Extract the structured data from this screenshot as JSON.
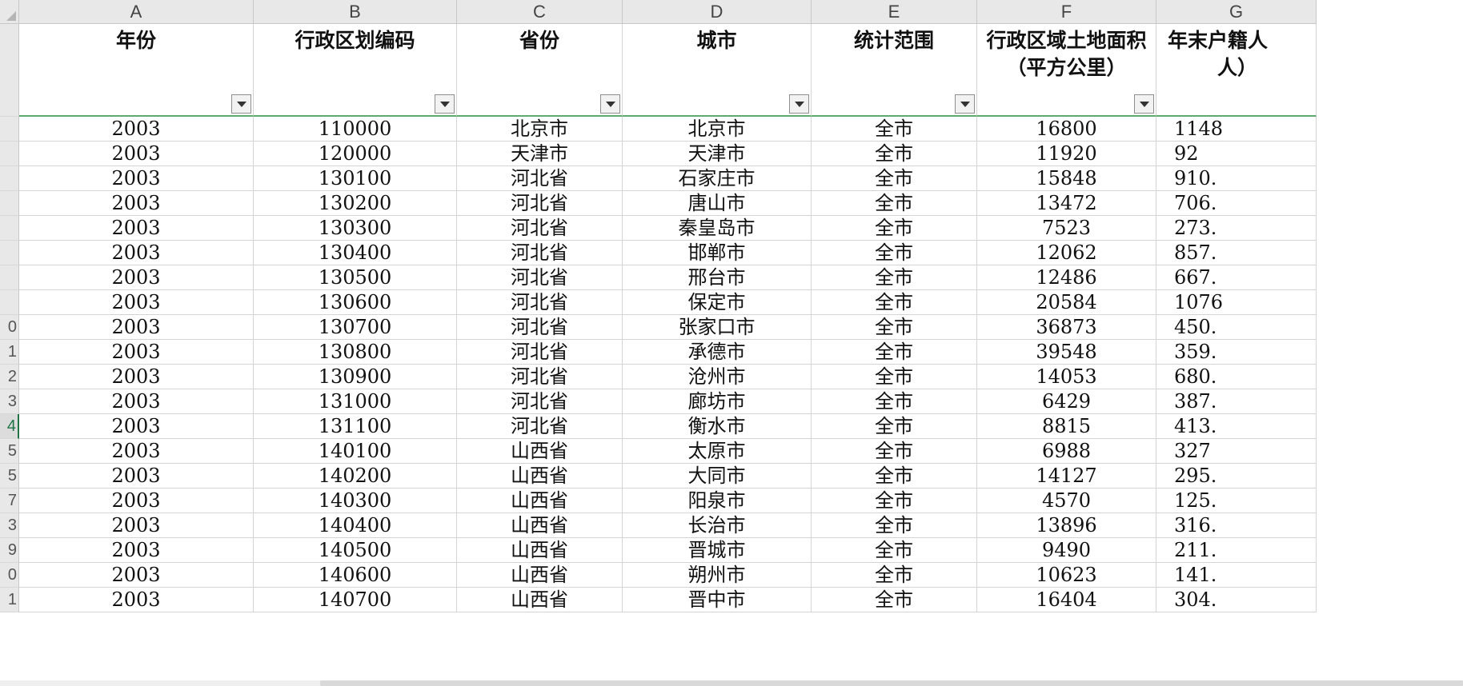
{
  "columns": [
    {
      "letter": "A",
      "header_lines": [
        "年份"
      ]
    },
    {
      "letter": "B",
      "header_lines": [
        "行政区划编码"
      ]
    },
    {
      "letter": "C",
      "header_lines": [
        "省份"
      ]
    },
    {
      "letter": "D",
      "header_lines": [
        "城市"
      ]
    },
    {
      "letter": "E",
      "header_lines": [
        "统计范围"
      ]
    },
    {
      "letter": "F",
      "header_lines": [
        "行政区域土地面积",
        "（平方公里）"
      ]
    },
    {
      "letter": "G",
      "header_lines": [
        "年末户籍人",
        "人）"
      ]
    }
  ],
  "row_numbers": [
    "",
    "",
    "",
    "",
    "",
    "",
    "",
    "",
    "",
    "0",
    "1",
    "2",
    "3",
    "4",
    "5",
    "5",
    "7",
    "3",
    "9",
    "0",
    "1"
  ],
  "active_row_index": 12,
  "rows": [
    [
      "2003",
      "110000",
      "北京市",
      "北京市",
      "全市",
      "16800",
      "1148"
    ],
    [
      "2003",
      "120000",
      "天津市",
      "天津市",
      "全市",
      "11920",
      "92"
    ],
    [
      "2003",
      "130100",
      "河北省",
      "石家庄市",
      "全市",
      "15848",
      "910."
    ],
    [
      "2003",
      "130200",
      "河北省",
      "唐山市",
      "全市",
      "13472",
      "706."
    ],
    [
      "2003",
      "130300",
      "河北省",
      "秦皇岛市",
      "全市",
      "7523",
      "273."
    ],
    [
      "2003",
      "130400",
      "河北省",
      "邯郸市",
      "全市",
      "12062",
      "857."
    ],
    [
      "2003",
      "130500",
      "河北省",
      "邢台市",
      "全市",
      "12486",
      "667."
    ],
    [
      "2003",
      "130600",
      "河北省",
      "保定市",
      "全市",
      "20584",
      "1076"
    ],
    [
      "2003",
      "130700",
      "河北省",
      "张家口市",
      "全市",
      "36873",
      "450."
    ],
    [
      "2003",
      "130800",
      "河北省",
      "承德市",
      "全市",
      "39548",
      "359."
    ],
    [
      "2003",
      "130900",
      "河北省",
      "沧州市",
      "全市",
      "14053",
      "680."
    ],
    [
      "2003",
      "131000",
      "河北省",
      "廊坊市",
      "全市",
      "6429",
      "387."
    ],
    [
      "2003",
      "131100",
      "河北省",
      "衡水市",
      "全市",
      "8815",
      "413."
    ],
    [
      "2003",
      "140100",
      "山西省",
      "太原市",
      "全市",
      "6988",
      "327"
    ],
    [
      "2003",
      "140200",
      "山西省",
      "大同市",
      "全市",
      "14127",
      "295."
    ],
    [
      "2003",
      "140300",
      "山西省",
      "阳泉市",
      "全市",
      "4570",
      "125."
    ],
    [
      "2003",
      "140400",
      "山西省",
      "长治市",
      "全市",
      "13896",
      "316."
    ],
    [
      "2003",
      "140500",
      "山西省",
      "晋城市",
      "全市",
      "9490",
      "211."
    ],
    [
      "2003",
      "140600",
      "山西省",
      "朔州市",
      "全市",
      "10623",
      "141."
    ],
    [
      "2003",
      "140700",
      "山西省",
      "晋中市",
      "全市",
      "16404",
      "304."
    ]
  ],
  "colors": {
    "header_bg": "#e8e8e8",
    "grid_line": "#d4d4d4",
    "active_accent": "#217346",
    "header_underline": "#5fa86e"
  }
}
